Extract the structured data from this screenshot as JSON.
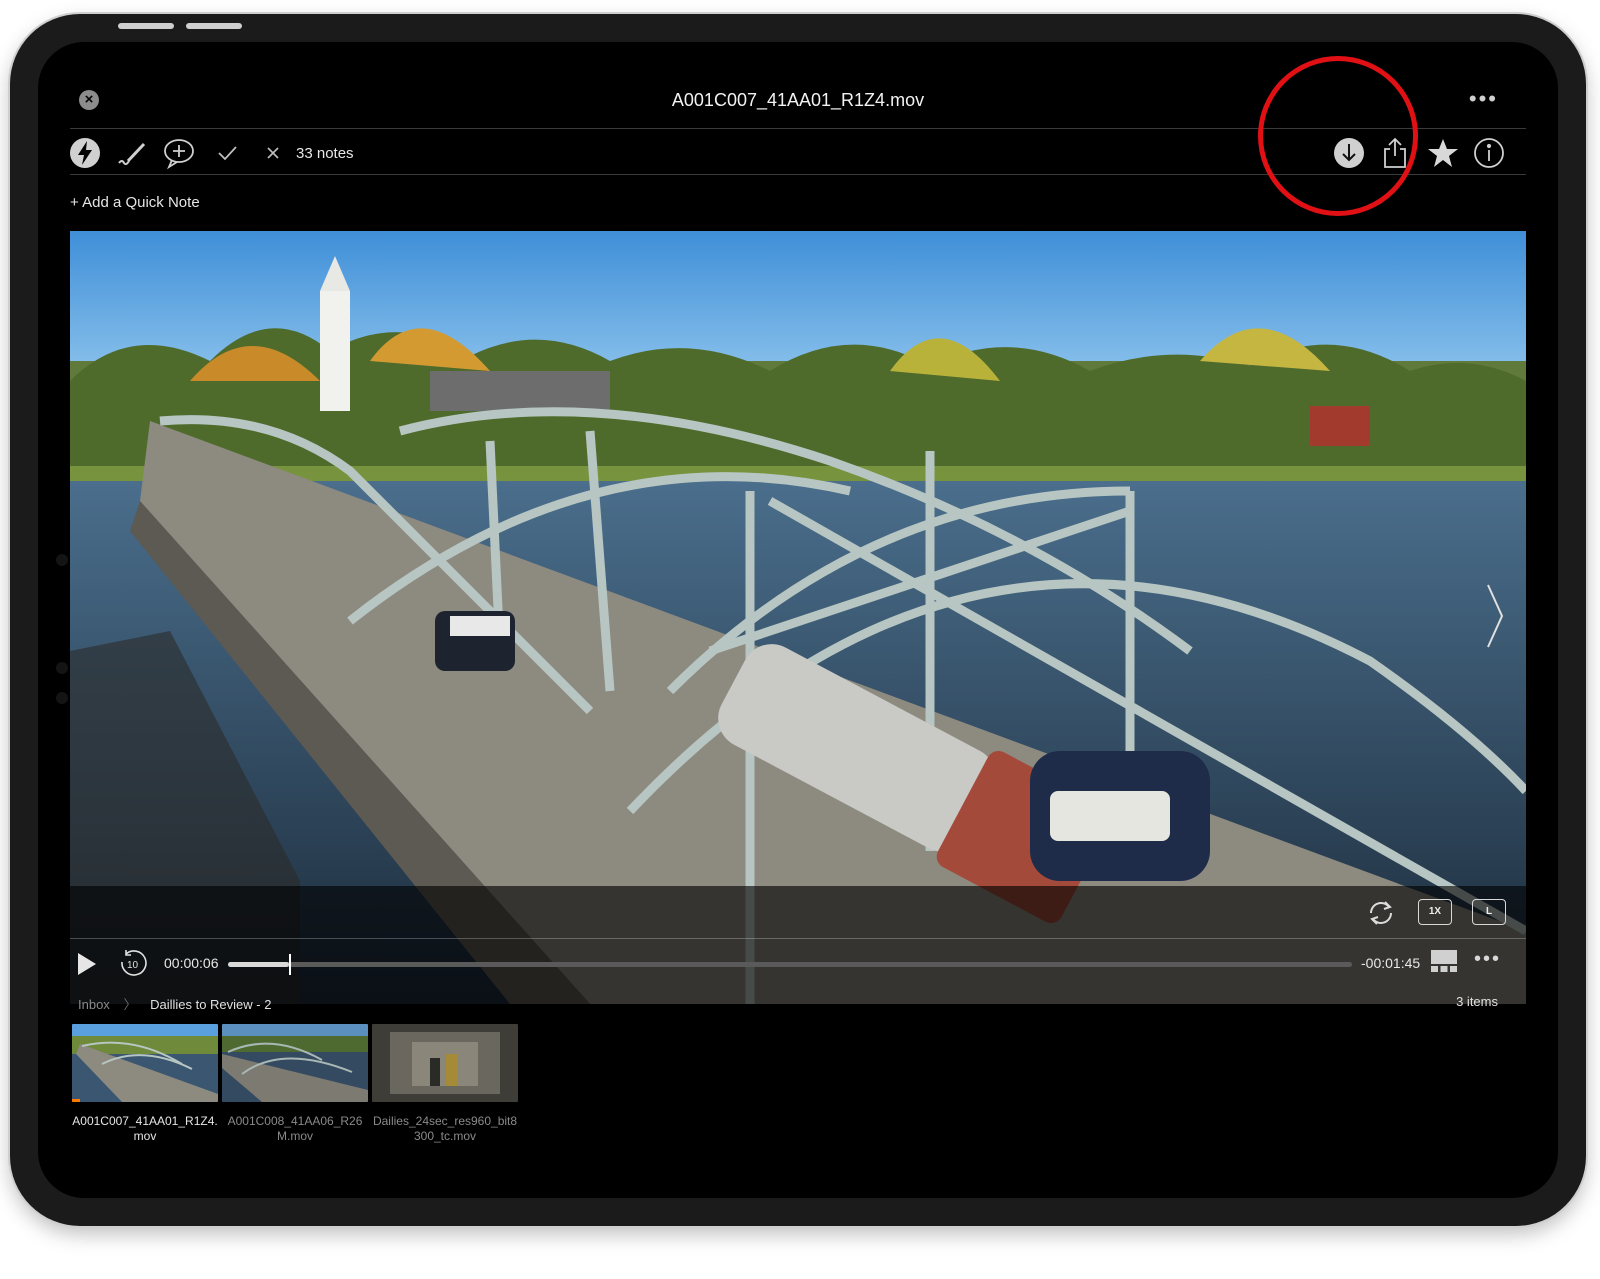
{
  "window": {
    "title": "A001C007_41AA01_R1Z4.mov",
    "more_label": "•••"
  },
  "toolbar": {
    "notes_count": "33 notes",
    "icons": [
      "lightning-icon",
      "pencil-icon",
      "add-comment-icon",
      "checkmark-icon",
      "close-icon",
      "download-icon",
      "share-icon",
      "star-icon",
      "info-icon"
    ]
  },
  "quick_note": {
    "label": "+ Add a Quick Note"
  },
  "player": {
    "current_time": "00:00:06",
    "remaining_time": "-00:01:45",
    "progress": 0.054,
    "speed_label": "1X",
    "layout_label": "L",
    "rewind_label": "10",
    "more_label": "•••"
  },
  "breadcrumb": {
    "root": "Inbox",
    "separator": "〉",
    "current": "Daillies to Review - 2",
    "items_count": "3 items"
  },
  "thumbnails": [
    {
      "label": "A001C007_41AA01_R1Z4.mov",
      "active": true
    },
    {
      "label": "A001C008_41AA06_R26M.mov",
      "active": false
    },
    {
      "label": "Dailies_24sec_res960_bit8300_tc.mov",
      "active": false
    }
  ],
  "colors": {
    "annotation": "#e01015",
    "accent": "#ff7a00",
    "background": "#000000"
  }
}
